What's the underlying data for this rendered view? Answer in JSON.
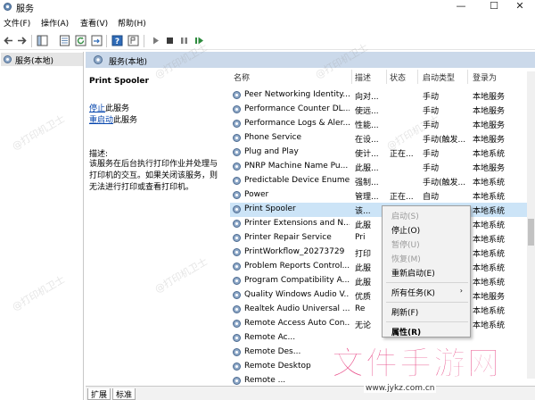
{
  "window": {
    "title": "服务",
    "minimize": "—",
    "maximize": "☐",
    "close": "✕"
  },
  "menu": [
    "文件(F)",
    "操作(A)",
    "查看(V)",
    "帮助(H)"
  ],
  "tree": {
    "item": "服务(本地)"
  },
  "header": {
    "title": "服务(本地)"
  },
  "detail": {
    "name": "Print Spooler",
    "stop_link": "停止",
    "stop_suffix": "此服务",
    "restart_link": "重启动",
    "restart_suffix": "此服务",
    "desc_label": "描述:",
    "desc_text": "该服务在后台执行打印作业并处理与打印机的交互。如果关闭该服务，则无法进行打印或查看打印机。"
  },
  "columns": {
    "name": "名称",
    "desc": "描述",
    "status": "状态",
    "startup": "启动类型",
    "logon": "登录为"
  },
  "rows": [
    {
      "name": "Peer Networking Identity...",
      "desc": "向对...",
      "status": "",
      "startup": "手动",
      "logon": "本地服务"
    },
    {
      "name": "Performance Counter DL...",
      "desc": "使远...",
      "status": "",
      "startup": "手动",
      "logon": "本地服务"
    },
    {
      "name": "Performance Logs & Aler...",
      "desc": "性能...",
      "status": "",
      "startup": "手动",
      "logon": "本地服务"
    },
    {
      "name": "Phone Service",
      "desc": "在设...",
      "status": "",
      "startup": "手动(触发...",
      "logon": "本地服务"
    },
    {
      "name": "Plug and Play",
      "desc": "使计...",
      "status": "正在...",
      "startup": "手动",
      "logon": "本地系统"
    },
    {
      "name": "PNRP Machine Name Pu...",
      "desc": "此服...",
      "status": "",
      "startup": "手动",
      "logon": "本地服务"
    },
    {
      "name": "Predictable Device Enumera...",
      "desc": "强制...",
      "status": "",
      "startup": "手动(触发...",
      "logon": "本地系统"
    },
    {
      "name": "Power",
      "desc": "管理...",
      "status": "正在...",
      "startup": "自动",
      "logon": "本地系统"
    },
    {
      "name": "Print Spooler",
      "desc": "该...",
      "status": "",
      "startup": "",
      "logon": "本地系统"
    },
    {
      "name": "Printer Extensions and N...",
      "desc": "此服",
      "status": "",
      "startup": "",
      "logon": "本地系统"
    },
    {
      "name": "Printer Repair Service",
      "desc": "Pri",
      "status": "",
      "startup": "",
      "logon": "本地系统"
    },
    {
      "name": "PrintWorkflow_20273729",
      "desc": "打印",
      "status": "",
      "startup": "",
      "logon": "本地系统"
    },
    {
      "name": "Problem Reports Control...",
      "desc": "此服",
      "status": "",
      "startup": "",
      "logon": "本地系统"
    },
    {
      "name": "Program Compatibility A...",
      "desc": "此服",
      "status": "",
      "startup": "",
      "logon": "本地系统"
    },
    {
      "name": "Quality Windows Audio V...",
      "desc": "优质",
      "status": "",
      "startup": "",
      "logon": "本地服务"
    },
    {
      "name": "Realtek Audio Universal ...",
      "desc": "Re",
      "status": "",
      "startup": "",
      "logon": "本地系统"
    },
    {
      "name": "Remote Access Auto Con...",
      "desc": "无论",
      "status": "",
      "startup": "",
      "logon": "本地系统"
    },
    {
      "name": "Remote Ac...",
      "desc": "",
      "status": "",
      "startup": "",
      "logon": ""
    },
    {
      "name": "Remote Des...",
      "desc": "",
      "status": "",
      "startup": "",
      "logon": ""
    },
    {
      "name": "Remote Desktop",
      "desc": "",
      "status": "",
      "startup": "",
      "logon": ""
    },
    {
      "name": "Remote ...",
      "desc": "",
      "status": "",
      "startup": "",
      "logon": ""
    }
  ],
  "context_menu": {
    "start": "启动(S)",
    "stop": "停止(O)",
    "pause": "暂停(U)",
    "resume": "恢复(M)",
    "restart": "重新启动(E)",
    "all_tasks": "所有任务(K)",
    "refresh": "刷新(F)",
    "properties": "属性(R)"
  },
  "tabs": [
    "扩展",
    "标准"
  ],
  "watermark": {
    "text": "@打印机卫士",
    "logo": "文件手游网",
    "url": "www.jykz.com.cn"
  },
  "colors": {
    "selected_row": "#cce4f7",
    "header_bg": "#cbd9ea",
    "link": "#0645ad"
  }
}
